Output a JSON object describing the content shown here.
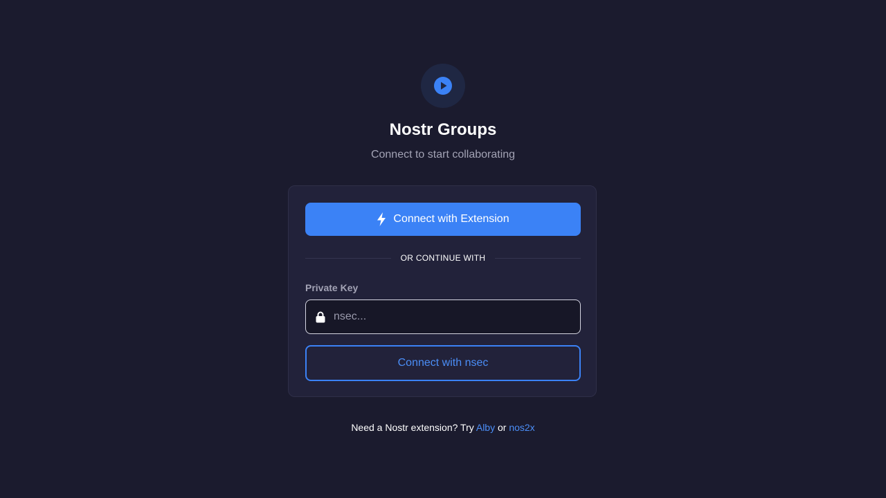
{
  "app": {
    "title": "Nostr Groups",
    "subtitle": "Connect to start collaborating",
    "logo_icon": "play-circle-icon"
  },
  "colors": {
    "background": "#1b1b2e",
    "card": "#22223a",
    "accent": "#3b82f6",
    "muted_text": "#a3a3b5"
  },
  "login": {
    "extension_button": {
      "label": "Connect with Extension",
      "icon": "lightning-bolt-icon"
    },
    "divider_text": "OR CONTINUE WITH",
    "private_key": {
      "label": "Private Key",
      "placeholder": "nsec...",
      "value": "",
      "icon": "lock-icon"
    },
    "nsec_button": {
      "label": "Connect with nsec"
    }
  },
  "footer": {
    "prefix": "Need a Nostr extension? Try",
    "link1": "Alby",
    "separator": "or",
    "link2": "nos2x"
  }
}
